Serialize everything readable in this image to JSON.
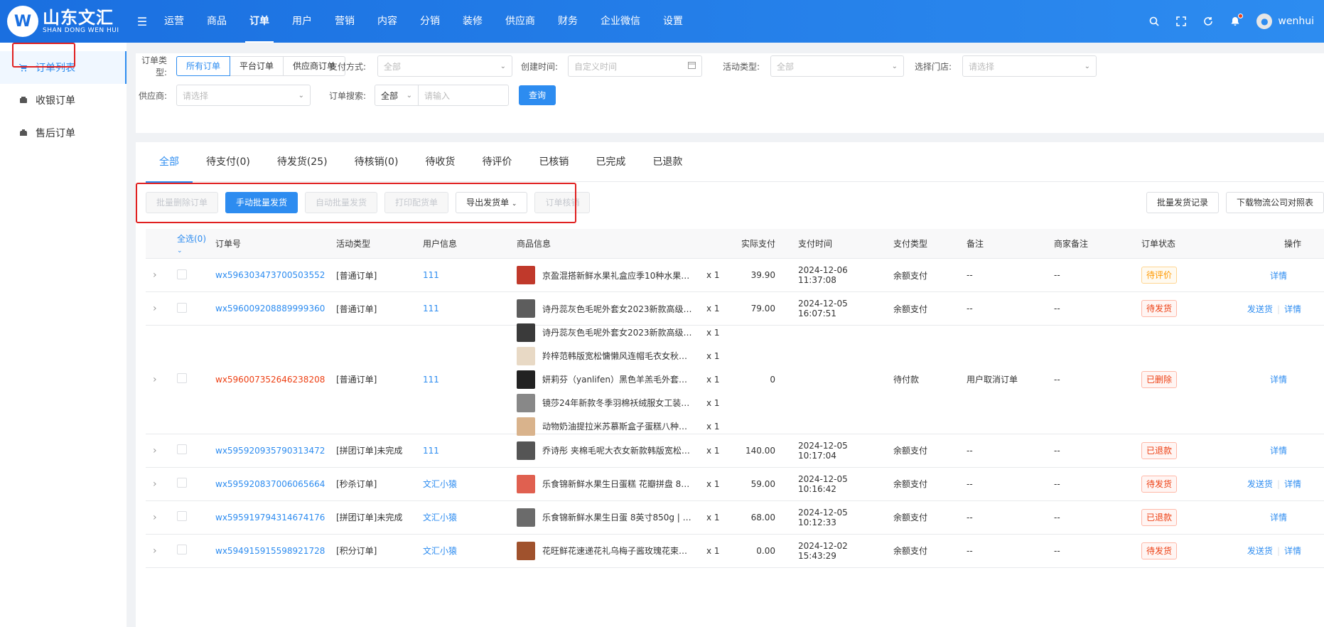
{
  "header": {
    "logo_cn": "山东文汇",
    "logo_en": "SHAN DONG WEN HUI",
    "nav": [
      "运营",
      "商品",
      "订单",
      "用户",
      "营销",
      "内容",
      "分销",
      "装修",
      "供应商",
      "财务",
      "企业微信",
      "设置"
    ],
    "active_nav": "订单",
    "username": "wenhui"
  },
  "sidebar": {
    "items": [
      {
        "label": "订单列表",
        "icon": "cart-icon"
      },
      {
        "label": "收银订单",
        "icon": "cashier-icon"
      },
      {
        "label": "售后订单",
        "icon": "aftersale-icon"
      }
    ]
  },
  "filters": {
    "order_type_label": "订单类型:",
    "order_types": [
      "所有订单",
      "平台订单",
      "供应商订单"
    ],
    "pay_method_label": "支付方式:",
    "pay_method_value": "全部",
    "create_time_label": "创建时间:",
    "create_time_placeholder": "自定义时间",
    "activity_label": "活动类型:",
    "activity_value": "全部",
    "store_label": "选择门店:",
    "store_placeholder": "请选择",
    "supplier_label": "供应商:",
    "supplier_placeholder": "请选择",
    "search_label": "订单搜索:",
    "search_scope": "全部",
    "search_placeholder": "请输入",
    "query_button": "查询"
  },
  "tabs": [
    "全部",
    "待支付(0)",
    "待发货(25)",
    "待核销(0)",
    "待收货",
    "待评价",
    "已核销",
    "已完成",
    "已退款"
  ],
  "actions": {
    "batch_delete": "批量删除订单",
    "manual_ship": "手动批量发货",
    "auto_ship": "自动批量发货",
    "print": "打印配货单",
    "export": "导出发货单",
    "verify": "订单核销",
    "ship_records": "批量发货记录",
    "download_logistics": "下载物流公司对照表"
  },
  "table": {
    "headers": {
      "select_all": "全选(0)",
      "order_no": "订单号",
      "activity": "活动类型",
      "user": "用户信息",
      "goods": "商品信息",
      "paid": "实际支付",
      "pay_time": "支付时间",
      "pay_type": "支付类型",
      "note": "备注",
      "merchant_note": "商家备注",
      "status": "订单状态",
      "op": "操作"
    },
    "op_labels": {
      "ship": "发送货",
      "detail": "详情"
    },
    "rows": [
      {
        "order_no": "wx596303473700503552",
        "activity": "[普通订单]",
        "user": "111",
        "goods": [
          {
            "name": "京盈混搭新鲜水果礼盒应季10种水果混...",
            "qty": "x 1"
          }
        ],
        "paid": "39.90",
        "time": "2024-12-06 11:37:08",
        "ptype": "余额支付",
        "note": "--",
        "mnote": "--",
        "status": "待评价",
        "status_kind": "warn",
        "ship": false
      },
      {
        "order_no": "wx596009208889999360",
        "activity": "[普通订单]",
        "user": "111",
        "goods": [
          {
            "name": "诗丹蕊灰色毛呢外套女2023新款高级感...",
            "qty": "x 1"
          }
        ],
        "paid": "79.00",
        "time": "2024-12-05 16:07:51",
        "ptype": "余额支付",
        "note": "--",
        "mnote": "--",
        "status": "待发货",
        "status_kind": "err",
        "ship": true
      },
      {
        "order_no": "wx596007352646238208",
        "order_red": true,
        "activity": "[普通订单]",
        "user": "111",
        "goods": [
          {
            "name": "诗丹蕊灰色毛呢外套女2023新款高级感...",
            "qty": "x 1"
          },
          {
            "name": "羚梓范韩版宽松慵懒风连帽毛衣女秋冬2...",
            "qty": "x 1"
          },
          {
            "name": "妍莉芬（yanlifen）黑色羊羔毛外套女20...",
            "qty": "x 1"
          },
          {
            "name": "镜莎24年新款冬季羽棉袄绒服女工装派...",
            "qty": "x 1"
          },
          {
            "name": "动物奶油提拉米苏慕斯盒子蛋糕八种口味...",
            "qty": "x 1"
          }
        ],
        "paid": "0",
        "time": "",
        "ptype": "待付款",
        "note": "用户取消订单",
        "mnote": "--",
        "status": "已删除",
        "status_kind": "err",
        "ship": false
      },
      {
        "order_no": "wx595920935790313472",
        "activity": "[拼团订单]未完成",
        "user": "111",
        "goods": [
          {
            "name": "乔诗彤 夹棉毛呢大衣女新款韩版宽松小...",
            "qty": "x 1"
          }
        ],
        "paid": "140.00",
        "time": "2024-12-05 10:17:04",
        "ptype": "余额支付",
        "note": "--",
        "mnote": "--",
        "status": "已退款",
        "status_kind": "err",
        "ship": false
      },
      {
        "order_no": "wx595920837006065664",
        "activity": "[秒杀订单]",
        "user": "文汇小猿",
        "goods": [
          {
            "name": "乐食锦新鲜水果生日蛋糕 花瓣拼盘 8英...",
            "qty": "x 1"
          }
        ],
        "paid": "59.00",
        "time": "2024-12-05 10:16:42",
        "ptype": "余额支付",
        "note": "--",
        "mnote": "--",
        "status": "待发货",
        "status_kind": "err",
        "ship": true
      },
      {
        "order_no": "wx595919794314674176",
        "activity": "[拼团订单]未完成",
        "user": "文汇小猿",
        "goods": [
          {
            "name": "乐食锦新鲜水果生日蛋 8英寸850g | 默认",
            "qty": "x 1"
          }
        ],
        "paid": "68.00",
        "time": "2024-12-05 10:12:33",
        "ptype": "余额支付",
        "note": "--",
        "mnote": "--",
        "status": "已退款",
        "status_kind": "err",
        "ship": false
      },
      {
        "order_no": "wx594915915598921728",
        "activity": "[积分订单]",
        "user": "文汇小猿",
        "goods": [
          {
            "name": "花旺鲜花速递花礼乌梅子酱玫瑰花束鲜花...",
            "qty": "x 1"
          }
        ],
        "paid": "0.00",
        "time": "2024-12-02 15:43:29",
        "ptype": "余额支付",
        "note": "--",
        "mnote": "--",
        "status": "待发货",
        "status_kind": "err",
        "ship": true
      }
    ]
  },
  "colors": {
    "primary": "#2d8cf0",
    "danger": "#ed4014",
    "warning": "#ff9900",
    "highlight_box": "#e02020"
  }
}
